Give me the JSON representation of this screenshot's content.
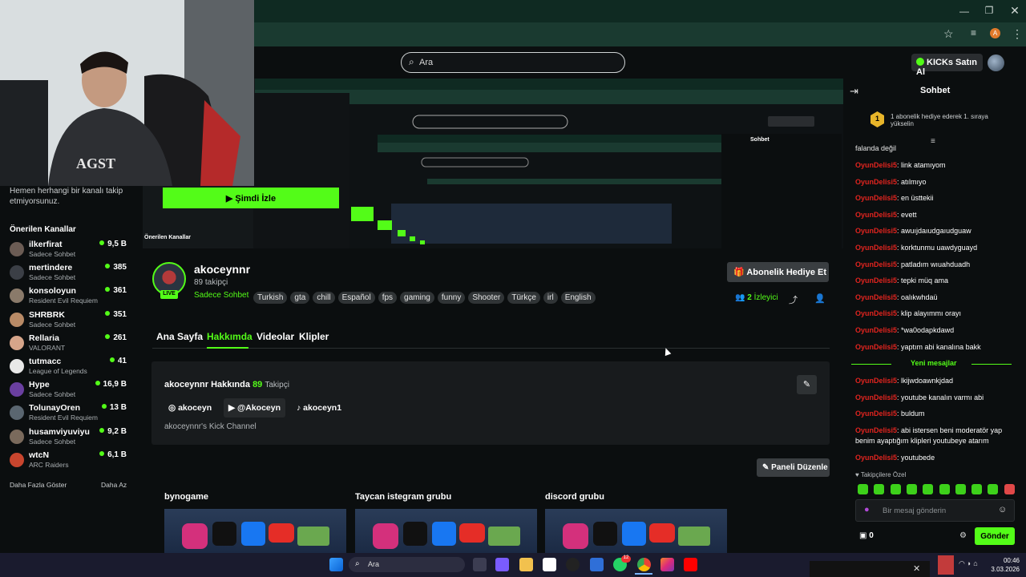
{
  "search": {
    "placeholder": "Ara"
  },
  "header": {
    "kicks_label": "KICKs Satın Al"
  },
  "sidebar": {
    "following_text": "etmiyorsunuz.",
    "following_partial": "Hemen herhangi bir kanalı takip",
    "recommended_title": "Önerilen Kanallar",
    "channels": [
      {
        "name": "ilkerfirat",
        "category": "Sadece Sohbet",
        "viewers": "9,5 B",
        "color": "#6b5c54"
      },
      {
        "name": "mertindere",
        "category": "Sadece Sohbet",
        "viewers": "385",
        "color": "#3b3f46"
      },
      {
        "name": "konsoloyun",
        "category": "Resident Evil Requiem",
        "viewers": "361",
        "color": "#8a7a6a"
      },
      {
        "name": "SHRBRK",
        "category": "Sadece Sohbet",
        "viewers": "351",
        "color": "#b88a66"
      },
      {
        "name": "Rellaria",
        "category": "VALORANT",
        "viewers": "261",
        "color": "#d6a58a"
      },
      {
        "name": "tutmacc",
        "category": "League of Legends",
        "viewers": "41",
        "color": "#e8e8e8"
      },
      {
        "name": "Hype",
        "category": "Sadece Sohbet",
        "viewers": "16,9 B",
        "color": "#6a3fa0"
      },
      {
        "name": "TolunayOren",
        "category": "Resident Evil Requiem",
        "viewers": "13 B",
        "color": "#5a6670"
      },
      {
        "name": "husamviyuviyu",
        "category": "Sadece Sohbet",
        "viewers": "9,2 B",
        "color": "#7a6a5c"
      },
      {
        "name": "wtcN",
        "category": "ARC Raiders",
        "viewers": "6,1 B",
        "color": "#c8452e"
      }
    ],
    "show_more": "Daha Fazla Göster",
    "show_less": "Daha Az"
  },
  "banner": {
    "watch_label": "Şimdi İzle",
    "preview_recommended": "Önerilen Kanallar",
    "preview_chat": "Sohbet"
  },
  "channel": {
    "name": "akoceynnr",
    "followers": "89 takipçi",
    "live": "LIVE",
    "category": "Sadece Sohbet",
    "tags": [
      "Turkish",
      "gta",
      "chill",
      "Español",
      "fps",
      "gaming",
      "funny",
      "Shooter",
      "Türkçe",
      "irl",
      "English"
    ],
    "gift_label": "Abonelik Hediye Et",
    "viewers_count": "2",
    "viewers_label": "İzleyici"
  },
  "tabs": {
    "home": "Ana Sayfa",
    "about": "Hakkımda",
    "videos": "Videolar",
    "clips": "Klipler"
  },
  "about": {
    "title": "akoceynnr Hakkında",
    "followers_count": "89",
    "followers_label": "Takipçi",
    "instagram": "akoceyn",
    "youtube": "@Akoceyn",
    "tiktok": "akoceyn1",
    "description": "akoceynnr's Kick Channel",
    "edit_panel": "Paneli Düzenle"
  },
  "panels": [
    {
      "title": "bynogame"
    },
    {
      "title": "Taycan istegram grubu"
    },
    {
      "title": "discord grubu"
    }
  ],
  "chat": {
    "title": "Sohbet",
    "gift_banner": "1 abonelik hediye ederek 1. sıraya yükselin",
    "partial_top": "falanda değil",
    "messages_before": [
      {
        "user": "OyunDelisi5",
        "text": ": link atamıyom"
      },
      {
        "user": "OyunDelisi5",
        "text": ": atılmıyo"
      },
      {
        "user": "OyunDelisi5",
        "text": ": en üsttekii"
      },
      {
        "user": "OyunDelisi5",
        "text": ": evett"
      },
      {
        "user": "OyunDelisi5",
        "text": ": awuıjdaıudgaıudguaw"
      },
      {
        "user": "OyunDelisi5",
        "text": ": korktunmu uawdyguayd"
      },
      {
        "user": "OyunDelisi5",
        "text": ": patladım wıuahduadh"
      },
      {
        "user": "OyunDelisi5",
        "text": ": tepki müq ama"
      },
      {
        "user": "OyunDelisi5",
        "text": ": oalıkwhdaü"
      },
      {
        "user": "OyunDelisi5",
        "text": ": klip alayımmı orayı"
      },
      {
        "user": "OyunDelisi5",
        "text": ": *wa0odapkdawd"
      },
      {
        "user": "OyunDelisi5",
        "text": ": yaptım abi kanalına bakk"
      }
    ],
    "new_messages": "Yeni mesajlar",
    "messages_after": [
      {
        "user": "OyunDelisi5",
        "text": ": lkijwdoawnkjdad"
      },
      {
        "user": "OyunDelisi5",
        "text": ": youtube kanalın varmı abi"
      },
      {
        "user": "OyunDelisi5",
        "text": ": buldum"
      },
      {
        "user": "OyunDelisi5",
        "text": ": abi istersen beni moderatör yap benim ayaptığım klipleri youtubeye atarım"
      },
      {
        "user": "OyunDelisi5",
        "text": ": youtubede"
      }
    ],
    "followers_only": "Takipçilere Özel",
    "input_placeholder": "Bir mesaj gönderin",
    "kicks_count": "0",
    "send_label": "Gönder"
  },
  "taskbar": {
    "search": "Ara",
    "time": "00:46",
    "date": "3.03.2026",
    "whatsapp_badge": "12"
  },
  "colors": {
    "accent": "#53fc18",
    "chat_user": "#e1241f",
    "background": "#0b0e0f"
  }
}
